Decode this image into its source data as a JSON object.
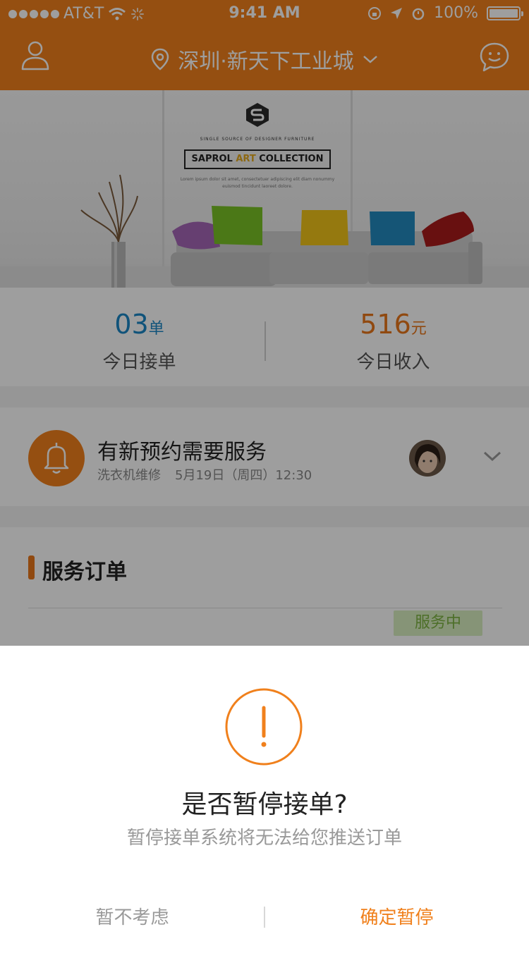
{
  "status_bar": {
    "carrier": "AT&T",
    "time": "9:41 AM",
    "battery": "100%"
  },
  "nav": {
    "location": "深圳·新天下工业城"
  },
  "banner": {
    "tagline": "SINGLE SOURCE OF DESIGNER FURNITURE",
    "brand_pre": "SAPROL ",
    "brand_art": "ART",
    "brand_post": " COLLECTION",
    "lorem": "Lorem ipsum dolor sit amet, consectetuer adipiscing elit diam nonummy euismod tincidunt laoreet dolore."
  },
  "stats": {
    "orders": {
      "value": "03",
      "unit": "单",
      "label": "今日接单"
    },
    "income": {
      "value": "516",
      "unit": "元",
      "label": "今日收入"
    }
  },
  "notice": {
    "title": "有新预约需要服务",
    "service": "洗衣机维修",
    "datetime": "5月19日（周四）12:30"
  },
  "orders": {
    "title": "服务订单",
    "status_badge": "服务中"
  },
  "dialog": {
    "title": "是否暂停接单?",
    "message": "暂停接单系统将无法给您推送订单",
    "cancel_label": "暂不考虑",
    "confirm_label": "确定暂停"
  },
  "colors": {
    "accent": "#f0801c",
    "blue": "#1a86c6",
    "badge_bg": "#d9efc1",
    "badge_text": "#7cb342"
  }
}
